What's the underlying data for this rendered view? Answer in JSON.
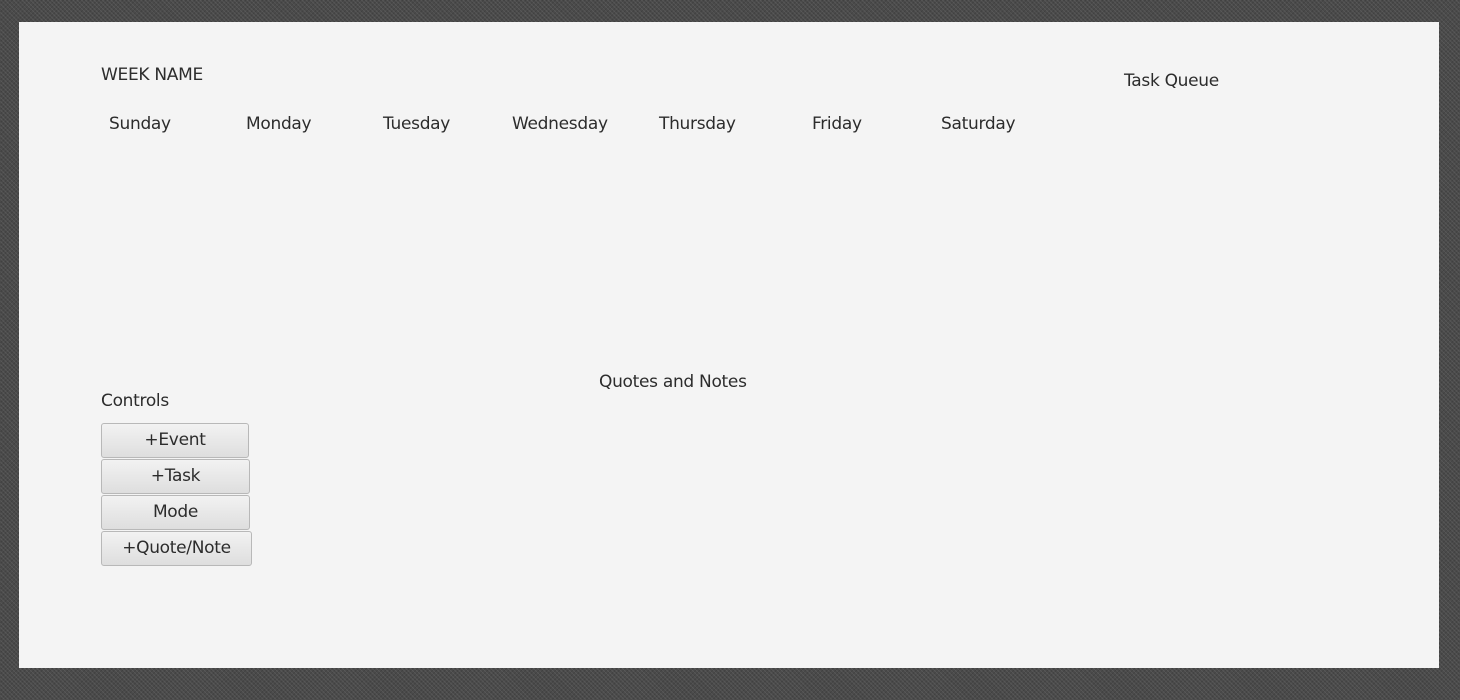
{
  "header": {
    "week_name": "WEEK NAME",
    "days": [
      "Sunday",
      "Monday",
      "Tuesday",
      "Wednesday",
      "Thursday",
      "Friday",
      "Saturday"
    ]
  },
  "task_queue": {
    "title": "Task Queue"
  },
  "notes": {
    "title": "Quotes and Notes"
  },
  "controls": {
    "title": "Controls",
    "buttons": {
      "event": "+Event",
      "task": "+Task",
      "mode": "Mode",
      "quote_note": "+Quote/Note"
    }
  }
}
